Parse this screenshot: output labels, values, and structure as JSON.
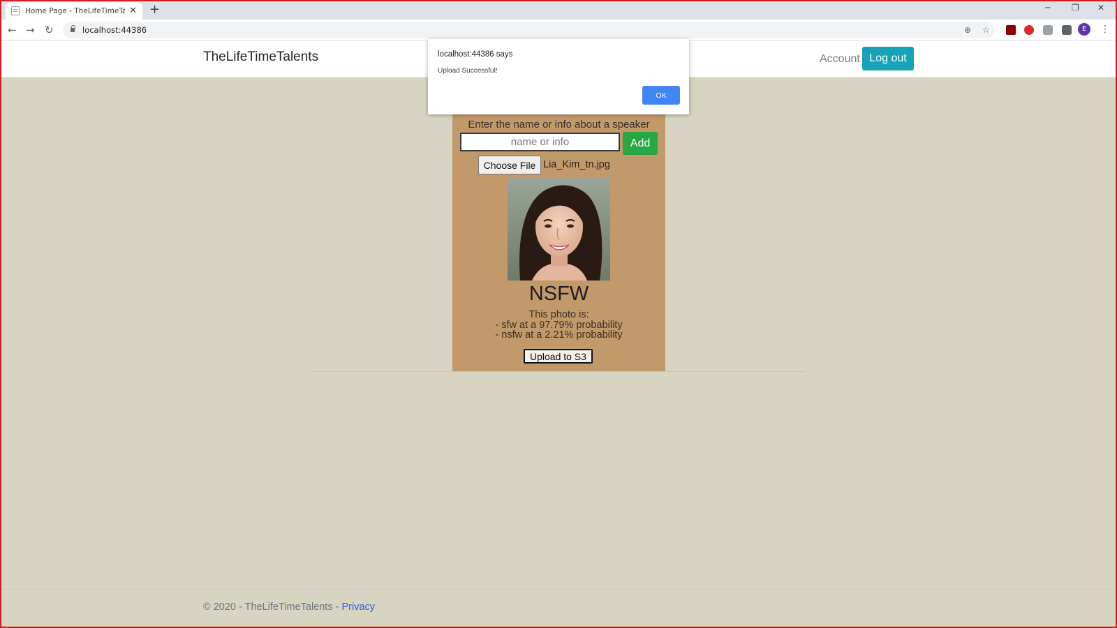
{
  "browser": {
    "tab_title": "Home Page - TheLifeTimeTalents",
    "tab_close": "✕",
    "new_tab": "+",
    "url": "localhost:44386",
    "back": "←",
    "forward": "→",
    "reload": "↻",
    "profile_initial": "E",
    "window_minimize": "─",
    "window_restore": "❐",
    "window_close": "✕",
    "zoom": "⊕",
    "bookmark": "☆",
    "menu": "⋮"
  },
  "header": {
    "brand": "TheLifeTimeTalents",
    "account_label": "Account",
    "logout_label": "Log out"
  },
  "form": {
    "prompt": "Enter the name or info about a speaker",
    "name_placeholder": "name or info",
    "add_label": "Add",
    "choose_file_label": "Choose File",
    "file_name": "Lia_Kim_tn.jpg"
  },
  "result": {
    "verdict": "NSFW",
    "line1": "This photo is:",
    "line2": "- sfw at a 97.79% probability",
    "line3": "- nsfw at a 2.21% probability",
    "upload_label": "Upload to S3"
  },
  "footer": {
    "copyright": "© 2020 - TheLifeTimeTalents - ",
    "privacy_label": "Privacy"
  },
  "dialog": {
    "title": "localhost:44386 says",
    "message": "Upload Successful!",
    "ok_label": "OK"
  },
  "colors": {
    "page_bg": "#d8d4c2",
    "card_bg": "#c2996b",
    "logout_bg": "#17a2b8",
    "add_bg": "#28a745",
    "ok_bg": "#4285f4",
    "frame": "#d11d24"
  }
}
